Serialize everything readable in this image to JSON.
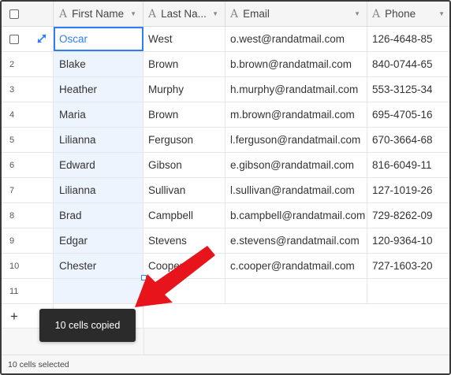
{
  "colors": {
    "accent": "#2d7ff9",
    "selected_column": "#eef4fd",
    "toast_bg": "#2b2b2b",
    "annotation_arrow": "#e8141c"
  },
  "columns": [
    {
      "label": "First Name",
      "icon": "text-field-icon"
    },
    {
      "label": "Last Na...",
      "icon": "text-field-icon"
    },
    {
      "label": "Email",
      "icon": "text-field-icon"
    },
    {
      "label": "Phone",
      "icon": "text-field-icon"
    }
  ],
  "rows": [
    {
      "num": "1",
      "first": "Oscar",
      "last": "West",
      "email": "o.west@randatmail.com",
      "phone": "126-4648-85"
    },
    {
      "num": "2",
      "first": "Blake",
      "last": "Brown",
      "email": "b.brown@randatmail.com",
      "phone": "840-0744-65"
    },
    {
      "num": "3",
      "first": "Heather",
      "last": "Murphy",
      "email": "h.murphy@randatmail.com",
      "phone": "553-3125-34"
    },
    {
      "num": "4",
      "first": "Maria",
      "last": "Brown",
      "email": "m.brown@randatmail.com",
      "phone": "695-4705-16"
    },
    {
      "num": "5",
      "first": "Lilianna",
      "last": "Ferguson",
      "email": "l.ferguson@randatmail.com",
      "phone": "670-3664-68"
    },
    {
      "num": "6",
      "first": "Edward",
      "last": "Gibson",
      "email": "e.gibson@randatmail.com",
      "phone": "816-6049-11"
    },
    {
      "num": "7",
      "first": "Lilianna",
      "last": "Sullivan",
      "email": "l.sullivan@randatmail.com",
      "phone": "127-1019-26"
    },
    {
      "num": "8",
      "first": "Brad",
      "last": "Campbell",
      "email": "b.campbell@randatmail.com",
      "phone": "729-8262-09"
    },
    {
      "num": "9",
      "first": "Edgar",
      "last": "Stevens",
      "email": "e.stevens@randatmail.com",
      "phone": "120-9364-10"
    },
    {
      "num": "10",
      "first": "Chester",
      "last": "Cooper",
      "email": "c.cooper@randatmail.com",
      "phone": "727-1603-20"
    }
  ],
  "empty_row_num": "11",
  "add_row_label": "+",
  "toast": "10 cells copied",
  "footer_status": "10 cells selected"
}
